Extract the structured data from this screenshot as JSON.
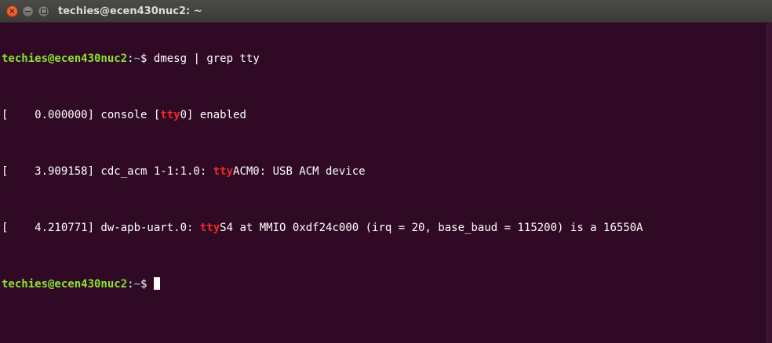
{
  "window": {
    "title": "techies@ecen430nuc2: ~"
  },
  "colors": {
    "background": "#300a24",
    "prompt_user": "#8ae234",
    "prompt_dir": "#729fcf",
    "match_highlight": "#ef2929",
    "text": "#ffffff"
  },
  "terminal": {
    "prompt_user_host": "techies@ecen430nuc2",
    "prompt_colon": ":",
    "prompt_dir": "~",
    "prompt_symbol": "$",
    "command": " dmesg | grep tty",
    "output": [
      {
        "before": "[    0.000000] console [",
        "match": "tty",
        "after": "0] enabled"
      },
      {
        "before": "[    3.909158] cdc_acm 1-1:1.0: ",
        "match": "tty",
        "after": "ACM0: USB ACM device"
      },
      {
        "before": "[    4.210771] dw-apb-uart.0: ",
        "match": "tty",
        "after": "S4 at MMIO 0xdf24c000 (irq = 20, base_baud = 115200) is a 16550A"
      }
    ],
    "second_prompt_symbol": "$ "
  }
}
